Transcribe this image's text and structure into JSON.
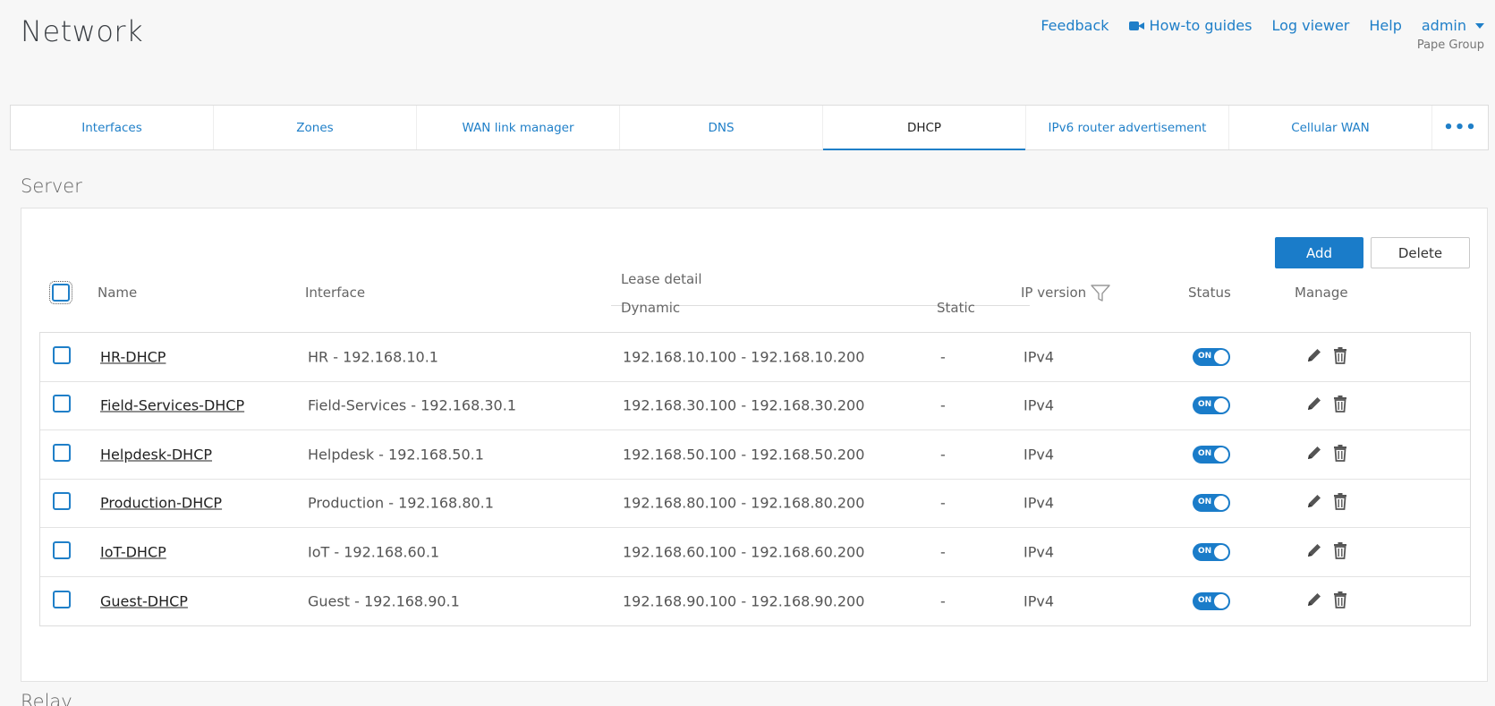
{
  "page": {
    "title": "Network"
  },
  "topnav": {
    "feedback": "Feedback",
    "howto": "How-to guides",
    "logviewer": "Log viewer",
    "help": "Help",
    "user": "admin",
    "org": "Pape Group"
  },
  "tabs": [
    {
      "label": "Interfaces"
    },
    {
      "label": "Zones"
    },
    {
      "label": "WAN link manager"
    },
    {
      "label": "DNS"
    },
    {
      "label": "DHCP",
      "active": true
    },
    {
      "label": "IPv6 router advertisement"
    },
    {
      "label": "Cellular WAN"
    }
  ],
  "tabs_more": "•••",
  "section": {
    "title": "Server",
    "next_peek": "Relay"
  },
  "toolbar": {
    "add_label": "Add",
    "delete_label": "Delete"
  },
  "table": {
    "headers": {
      "name": "Name",
      "interface": "Interface",
      "lease_detail": "Lease detail",
      "dynamic": "Dynamic",
      "static": "Static",
      "ip_version": "IP version",
      "status": "Status",
      "manage": "Manage"
    },
    "rows": [
      {
        "name": "HR-DHCP",
        "interface": "HR - 192.168.10.1",
        "dynamic": "192.168.10.100 - 192.168.10.200",
        "static": "-",
        "ip_version": "IPv4",
        "status": "ON"
      },
      {
        "name": "Field-Services-DHCP",
        "interface": "Field-Services - 192.168.30.1",
        "dynamic": "192.168.30.100 - 192.168.30.200",
        "static": "-",
        "ip_version": "IPv4",
        "status": "ON"
      },
      {
        "name": "Helpdesk-DHCP",
        "interface": "Helpdesk - 192.168.50.1",
        "dynamic": "192.168.50.100 - 192.168.50.200",
        "static": "-",
        "ip_version": "IPv4",
        "status": "ON"
      },
      {
        "name": "Production-DHCP",
        "interface": "Production - 192.168.80.1",
        "dynamic": "192.168.80.100 - 192.168.80.200",
        "static": "-",
        "ip_version": "IPv4",
        "status": "ON"
      },
      {
        "name": "IoT-DHCP",
        "interface": "IoT - 192.168.60.1",
        "dynamic": "192.168.60.100 - 192.168.60.200",
        "static": "-",
        "ip_version": "IPv4",
        "status": "ON"
      },
      {
        "name": "Guest-DHCP",
        "interface": "Guest - 192.168.90.1",
        "dynamic": "192.168.90.100 - 192.168.90.200",
        "static": "-",
        "ip_version": "IPv4",
        "status": "ON"
      }
    ]
  },
  "colors": {
    "accent": "#1a7cc9",
    "link": "#1f7fc8"
  }
}
